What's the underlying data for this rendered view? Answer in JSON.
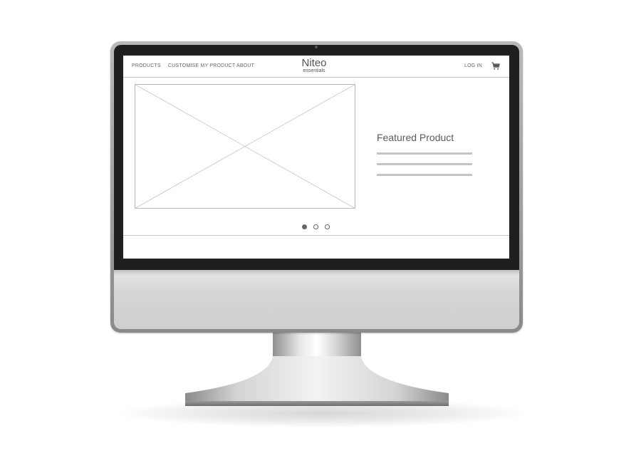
{
  "nav": {
    "products": "PRODUCTS",
    "customise": "CUSTOMISE MY PRODUCT",
    "about": "ABOUT",
    "login": "LOG IN",
    "cart_icon": "shopping-cart-icon"
  },
  "logo": {
    "main": "Niteo",
    "sub": "essentials"
  },
  "hero": {
    "image": "image-placeholder",
    "featured_title": "Featured Product"
  },
  "carousel": {
    "slide_count": 3,
    "active_index": 0
  },
  "colors": {
    "text_primary": "#555555",
    "nav_text": "#666666",
    "placeholder_lines": "#c4c4c4",
    "bezel": "#1f1f1f"
  }
}
